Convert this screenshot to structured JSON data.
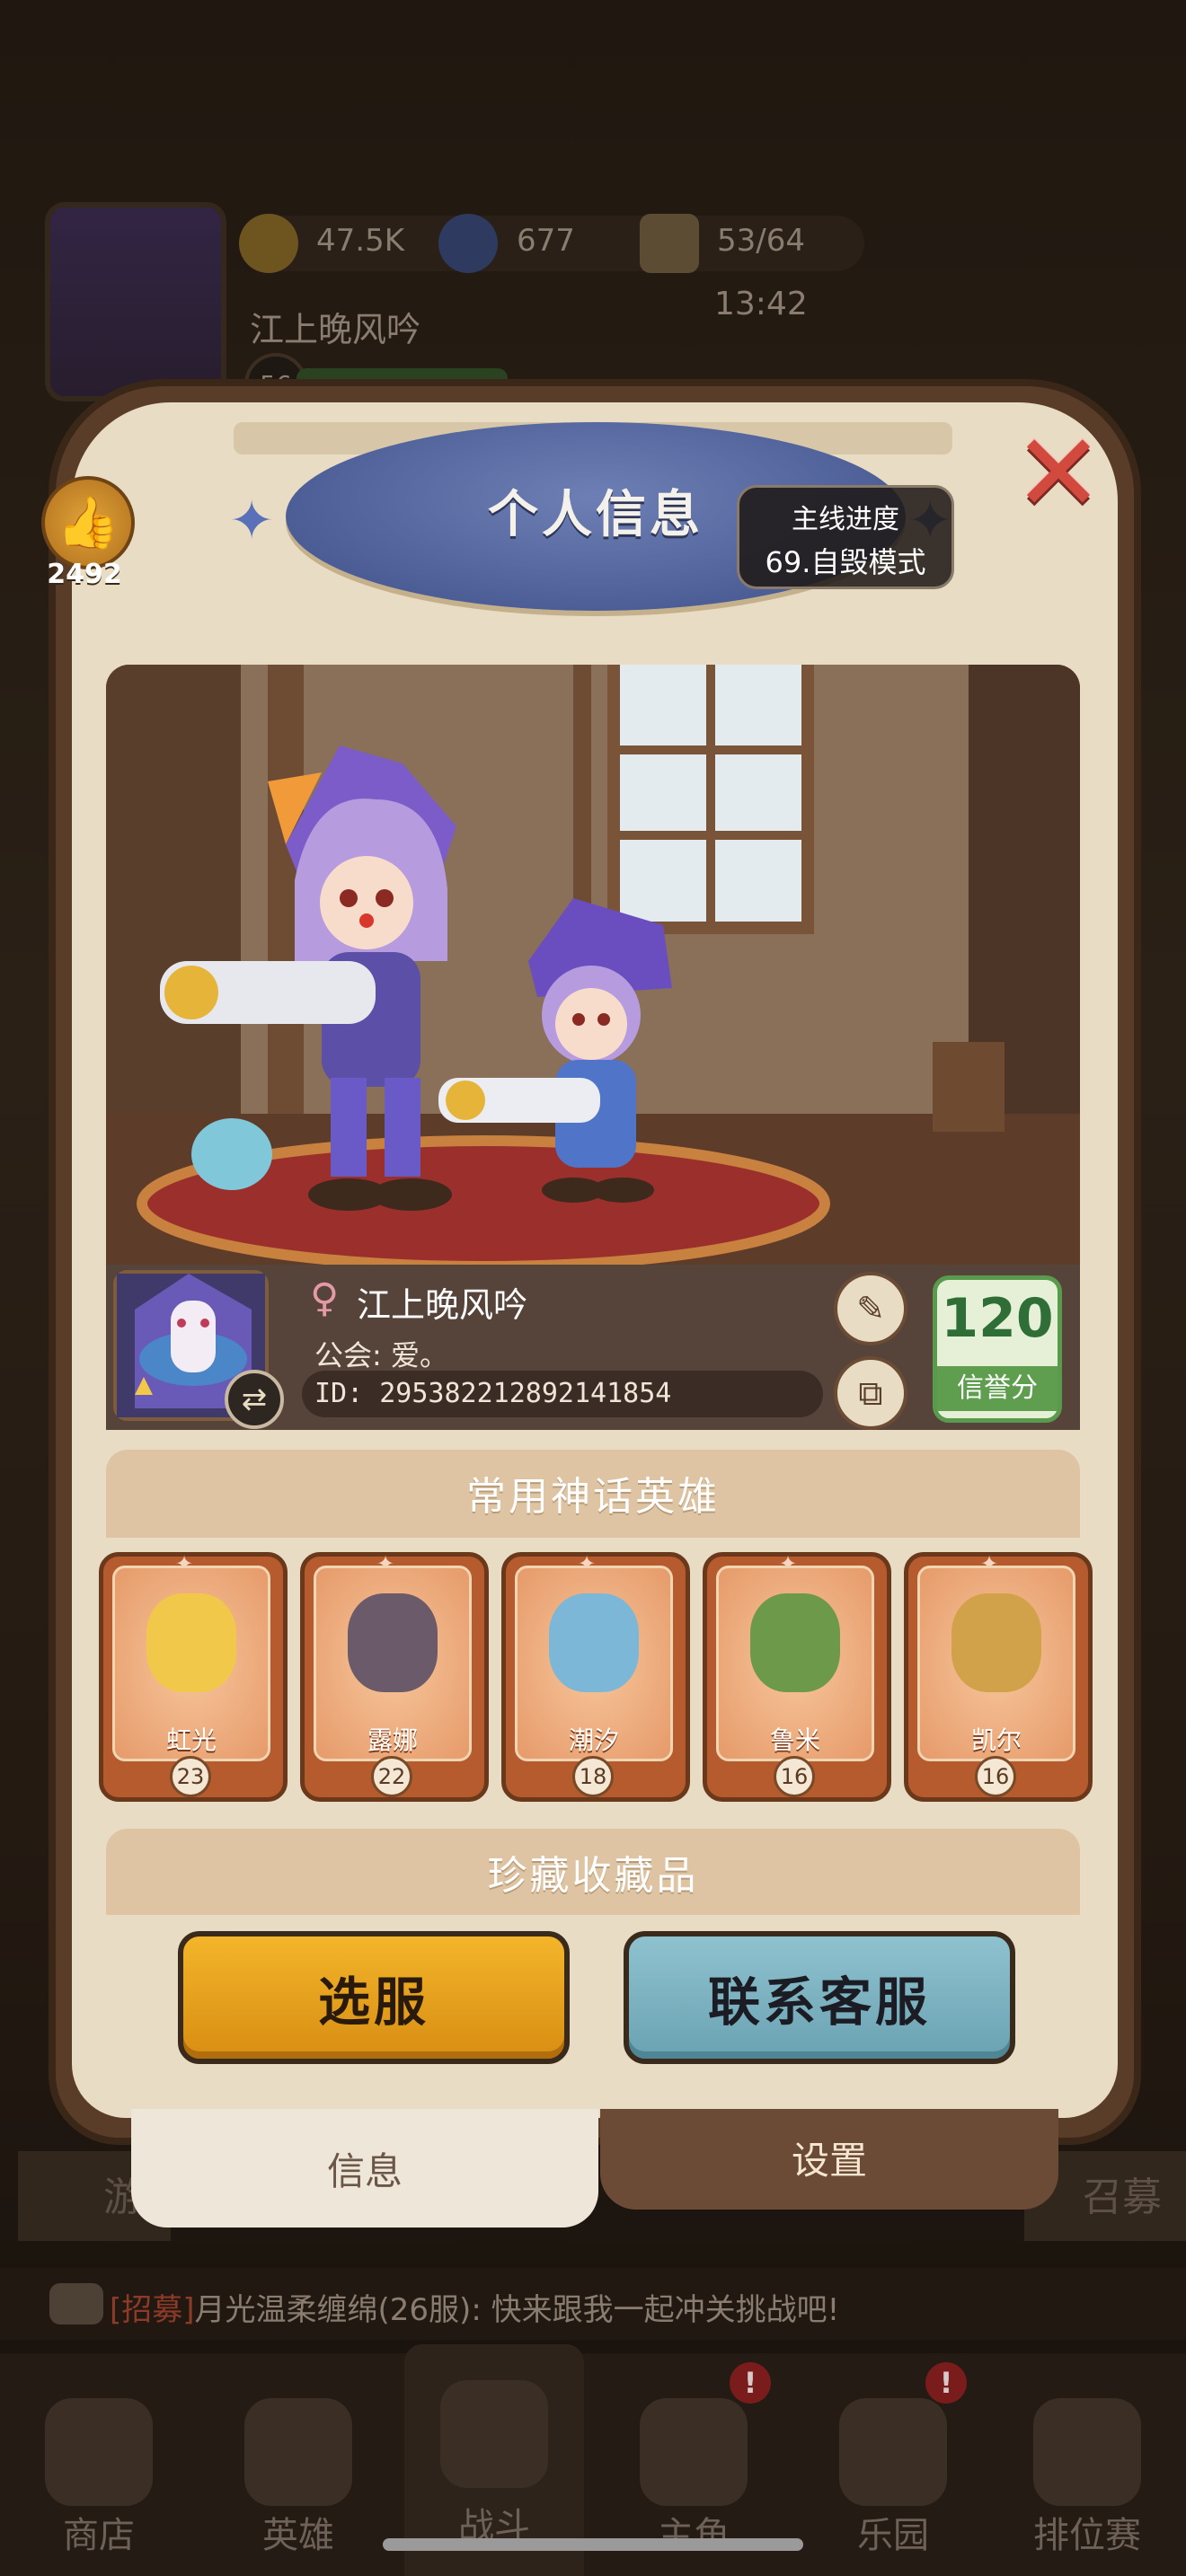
{
  "background": {
    "resources": [
      {
        "icon": "coin-icon",
        "value": "47.5K",
        "color": "#c8962e"
      },
      {
        "icon": "star-gem-icon",
        "value": "677",
        "color": "#5b6fb0"
      },
      {
        "icon": "biscuit-energy-icon",
        "value": "53/64",
        "color": "#b89868"
      }
    ],
    "player_name": "江上晚风吟",
    "level": "56",
    "timer": "13:42",
    "chat": {
      "tag": "[招募]",
      "message": "月光温柔缠绵(26服): 快来跟我一起冲关挑战吧!"
    },
    "nav": [
      {
        "label": "商店",
        "icon": "shop-icon"
      },
      {
        "label": "英雄",
        "icon": "hero-cards-icon"
      },
      {
        "label": "战斗",
        "icon": "battle-icon"
      },
      {
        "label": "主角",
        "icon": "protagonist-icon"
      },
      {
        "label": "乐园",
        "icon": "castle-icon"
      },
      {
        "label": "排位赛",
        "icon": "lock-icon"
      }
    ],
    "nav_badges": {
      "protagonist": "!",
      "park": "!"
    }
  },
  "modal": {
    "title": "个人信息",
    "main_progress": {
      "label": "主线进度",
      "value": "69.自毁模式"
    },
    "likes": "2492",
    "profile": {
      "name": "江上晚风吟",
      "gender": "female",
      "guild": "公会: 爱。",
      "id": "ID: 29538221289214185​4"
    },
    "reputation": {
      "value": "120",
      "label": "信誉分"
    },
    "heroes_section_title": "常用神话英雄",
    "heroes": [
      {
        "name": "虹光",
        "level": "23",
        "color": "#f2c84a"
      },
      {
        "name": "露娜",
        "level": "22",
        "color": "#6a5a6a"
      },
      {
        "name": "潮汐",
        "level": "18",
        "color": "#7db7d8"
      },
      {
        "name": "鲁米",
        "level": "16",
        "color": "#6d9a4a"
      },
      {
        "name": "凯尔",
        "level": "16",
        "color": "#d2a24a"
      }
    ],
    "collection_section_title": "珍藏收藏品",
    "buttons": {
      "select_server": "选服",
      "contact_support": "联系客服"
    },
    "tabs": {
      "info": "信息",
      "settings": "设置"
    }
  }
}
